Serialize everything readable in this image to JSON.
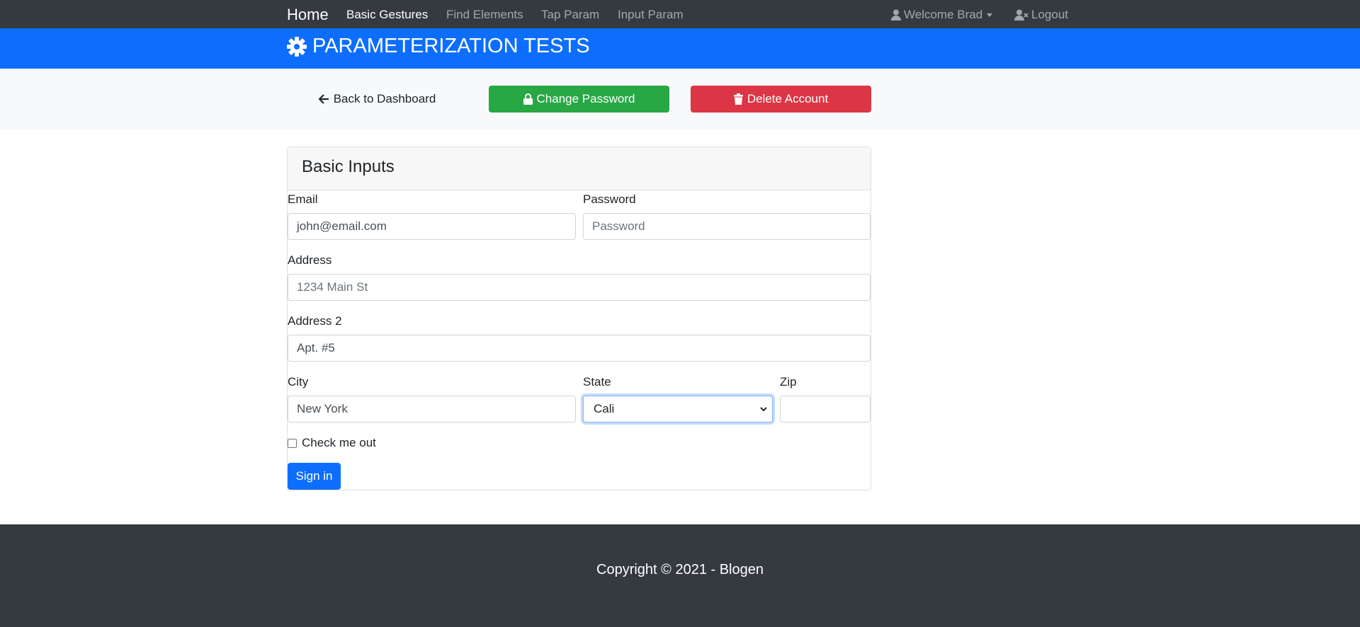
{
  "navbar": {
    "brand": "Home",
    "links": [
      "Basic Gestures",
      "Find Elements",
      "Tap Param",
      "Input Param"
    ],
    "user_menu": "Welcome Brad",
    "logout": "Logout"
  },
  "header": {
    "title": "PARAMETERIZATION TESTS",
    "icon": "gear-icon"
  },
  "actions": {
    "back": "Back to Dashboard",
    "change_password": "Change Password",
    "delete_account": "Delete Account"
  },
  "form": {
    "title": "Basic Inputs",
    "email_label": "Email",
    "email_value": "john@email.com",
    "password_label": "Password",
    "password_placeholder": "Password",
    "address_label": "Address",
    "address_placeholder": "1234 Main St",
    "address2_label": "Address 2",
    "address2_value": "Apt. #5",
    "city_label": "City",
    "city_value": "New York",
    "state_label": "State",
    "state_value": "Cali",
    "zip_label": "Zip",
    "zip_value": "",
    "checkbox_label": "Check me out",
    "submit": "Sign in"
  },
  "footer": {
    "copyright": "Copyright © 2021 - Blogen"
  },
  "colors": {
    "primary": "#0d6efd",
    "success": "#28a745",
    "danger": "#dc3545",
    "dark": "#343a40"
  }
}
